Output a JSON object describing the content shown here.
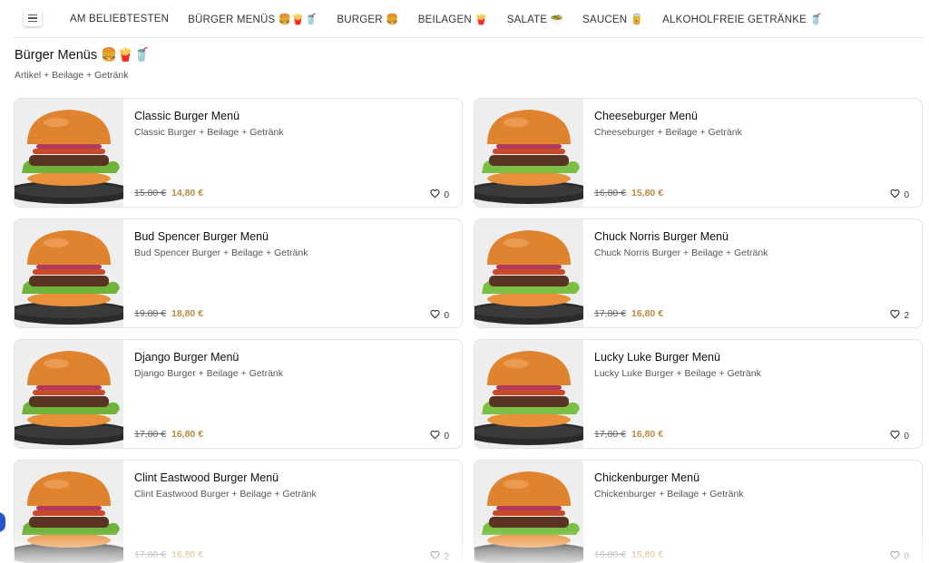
{
  "nav": {
    "items": [
      "AM BELIEBTESTEN",
      "BÜRGER MENÜS 🍔🍟🥤",
      "BURGER 🍔",
      "BEILAGEN 🍟",
      "SALATE 🥗",
      "SAUCEN 🥫",
      "ALKOHOLFREIE GETRÄNKE 🥤"
    ]
  },
  "section": {
    "title": "Bürger Menüs 🍔🍟🥤",
    "subtitle": "Artikel + Beilage + Getränk"
  },
  "products": [
    {
      "name": "Classic Burger Menü",
      "desc": "Classic Burger + Beilage + Getränk",
      "old_price": "15,80 €",
      "price": "14,80 €",
      "favs": "0"
    },
    {
      "name": "Cheeseburger Menü",
      "desc": "Cheeseburger + Beilage + Getränk",
      "old_price": "16,80 €",
      "price": "15,80 €",
      "favs": "0"
    },
    {
      "name": "Bud Spencer Burger Menü",
      "desc": "Bud Spencer Burger + Beilage + Getränk",
      "old_price": "19,80 €",
      "price": "18,80 €",
      "favs": "0"
    },
    {
      "name": "Chuck Norris Burger Menü",
      "desc": "Chuck Norris Burger + Beilage + Getränk",
      "old_price": "17,80 €",
      "price": "16,80 €",
      "favs": "2"
    },
    {
      "name": "Django Burger Menü",
      "desc": "Django Burger + Beilage + Getränk",
      "old_price": "17,80 €",
      "price": "16,80 €",
      "favs": "0"
    },
    {
      "name": "Lucky Luke Burger Menü",
      "desc": "Lucky Luke Burger + Beilage + Getränk",
      "old_price": "17,80 €",
      "price": "16,80 €",
      "favs": "0"
    },
    {
      "name": "Clint Eastwood Burger Menü",
      "desc": "Clint Eastwood Burger + Beilage + Getränk",
      "old_price": "17,80 €",
      "price": "16,80 €",
      "favs": "2"
    },
    {
      "name": "Chickenburger Menü",
      "desc": "Chickenburger + Beilage + Getränk",
      "old_price": "16,80 €",
      "price": "15,80 €",
      "favs": "0"
    }
  ],
  "colors": {
    "accent_price": "#b88a3e",
    "bun": "#e0832f",
    "lettuce": "#6fb33a",
    "patty": "#5a3423",
    "onion": "#b23a5c",
    "plate": "#2a2a2a"
  },
  "icons": {
    "menu": "hamburger-menu-icon",
    "favorite": "heart-outline-icon"
  }
}
